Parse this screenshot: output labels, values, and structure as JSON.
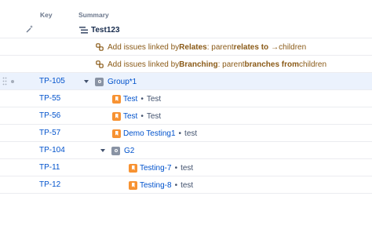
{
  "header": {
    "key": "Key",
    "summary": "Summary"
  },
  "root": {
    "title": "Test123",
    "icon": "hierarchy-icon"
  },
  "links": [
    {
      "prefix": "Add issues linked by ",
      "link_name": "Relates",
      "mid": ": parent ",
      "relation": "relates to",
      "arrow": "→",
      "suffix": " children"
    },
    {
      "prefix": "Add issues linked by ",
      "link_name": "Branching",
      "mid": ": parent ",
      "relation": "branches from",
      "arrow": "",
      "suffix": " children"
    }
  ],
  "rows": [
    {
      "key": "TP-105",
      "title": "Group*1",
      "status": "",
      "type": "group"
    },
    {
      "key": "TP-55",
      "title": "Test",
      "sep": "•",
      "status": "Test",
      "type": "story"
    },
    {
      "key": "TP-56",
      "title": "Test",
      "sep": "•",
      "status": "Test",
      "type": "story"
    },
    {
      "key": "TP-57",
      "title": "Demo Testing1",
      "sep": "•",
      "status": "test",
      "type": "story"
    },
    {
      "key": "TP-104",
      "title": "G2",
      "status": "",
      "type": "group"
    },
    {
      "key": "TP-11",
      "title": "Testing-7",
      "sep": "•",
      "status": "test",
      "type": "story"
    },
    {
      "key": "TP-12",
      "title": "Testing-8",
      "sep": "•",
      "status": "test",
      "type": "story"
    }
  ],
  "colors": {
    "link": "#0052cc",
    "link_rule": "#8a5a17",
    "story": "#f79232",
    "group": "#8993a4",
    "selected_row": "#ebf2fd"
  }
}
